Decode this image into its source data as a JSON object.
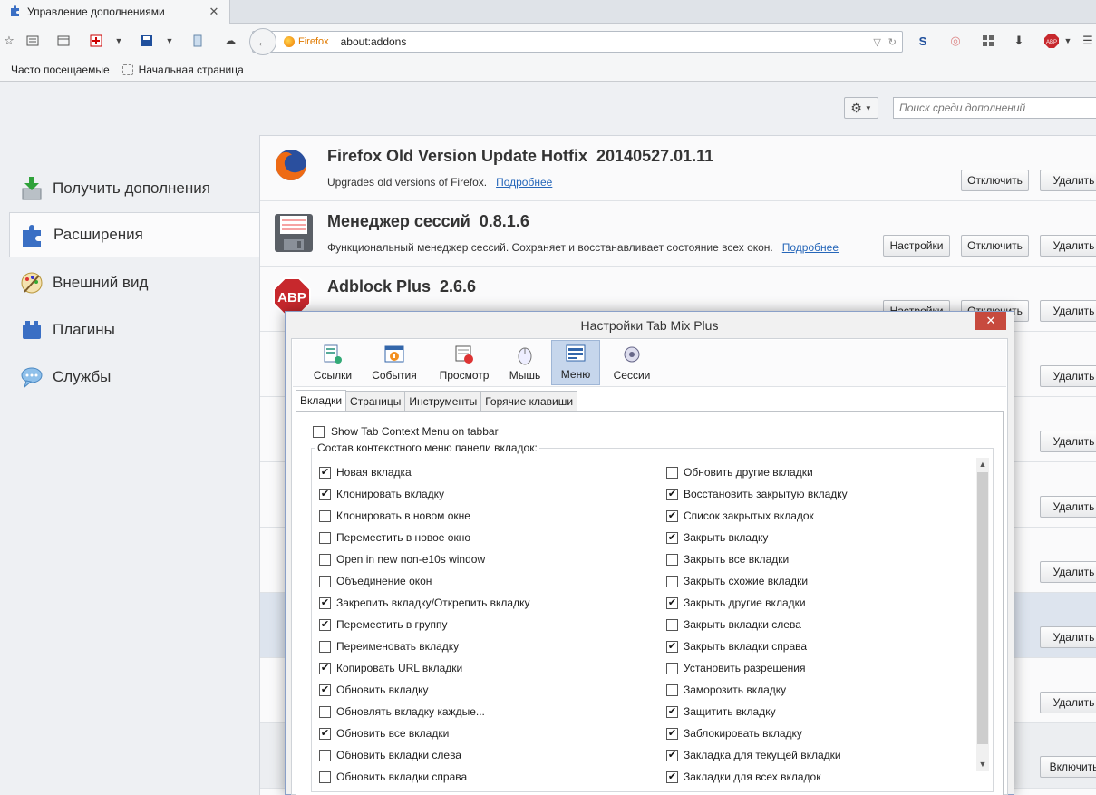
{
  "tab": {
    "title": "Управление дополнениями",
    "close": "✕"
  },
  "nav": {
    "identity_label": "Firefox",
    "url": "about:addons"
  },
  "bookmarks": {
    "items": [
      "Часто посещаемые",
      "Начальная страница"
    ]
  },
  "addons_page": {
    "search_placeholder": "Поиск среди дополнений",
    "categories": [
      {
        "label": "Получить дополнения",
        "icon": "download-icon"
      },
      {
        "label": "Расширения",
        "icon": "puzzle-icon"
      },
      {
        "label": "Внешний вид",
        "icon": "brush-icon"
      },
      {
        "label": "Плагины",
        "icon": "plugin-icon"
      },
      {
        "label": "Службы",
        "icon": "chat-icon"
      }
    ],
    "addons": [
      {
        "name": "Firefox Old Version Update Hotfix",
        "version": "20140527.01.11",
        "description": "Upgrades old versions of Firefox.",
        "more": "Подробнее",
        "buttons": [
          "Отключить",
          "Удалить"
        ]
      },
      {
        "name": "Менеджер сессий",
        "version": "0.8.1.6",
        "description": "Функциональный менеджер сессий. Сохраняет и восстанавливает состояние всех окон.",
        "more": "Подробнее",
        "buttons": [
          "Настройки",
          "Отключить",
          "Удалить"
        ]
      },
      {
        "name": "Adblock Plus",
        "version": "2.6.6",
        "description": "",
        "more": "",
        "buttons": [
          "Настройки",
          "Отключить",
          "Удалить"
        ]
      }
    ],
    "remove_label": "Удалить",
    "enable_label": "Включить"
  },
  "dialog": {
    "title": "Настройки Tab Mix Plus",
    "close": "✕",
    "toolbar": [
      "Ссылки",
      "События",
      "Просмотр",
      "Мышь",
      "Меню",
      "Сессии"
    ],
    "subtabs": [
      "Вкладки",
      "Страницы",
      "Инструменты",
      "Горячие клавиши"
    ],
    "top_check": {
      "label": "Show Tab Context Menu on tabbar",
      "checked": false
    },
    "group_label": "Состав контекстного меню панели вкладок:",
    "left_options": [
      {
        "label": "Новая вкладка",
        "checked": true
      },
      {
        "label": "Клонировать вкладку",
        "checked": true
      },
      {
        "label": "Клонировать в новом окне",
        "checked": false
      },
      {
        "label": "Переместить в новое окно",
        "checked": false
      },
      {
        "label": "Open in new non-e10s window",
        "checked": false
      },
      {
        "label": "Объединение окон",
        "checked": false
      },
      {
        "label": "Закрепить вкладку/Открепить вкладку",
        "checked": true
      },
      {
        "label": "Переместить в группу",
        "checked": true
      },
      {
        "label": "Переименовать вкладку",
        "checked": false
      },
      {
        "label": "Копировать URL вкладки",
        "checked": true
      },
      {
        "label": "Обновить вкладку",
        "checked": true
      },
      {
        "label": "Обновлять вкладку каждые...",
        "checked": false
      },
      {
        "label": "Обновить все вкладки",
        "checked": true
      },
      {
        "label": "Обновить вкладки слева",
        "checked": false
      },
      {
        "label": "Обновить вкладки справа",
        "checked": false
      }
    ],
    "right_options": [
      {
        "label": "Обновить другие вкладки",
        "checked": false
      },
      {
        "label": "Восстановить закрытую вкладку",
        "checked": true
      },
      {
        "label": "Список закрытых вкладок",
        "checked": true
      },
      {
        "label": "Закрыть вкладку",
        "checked": true
      },
      {
        "label": "Закрыть все вкладки",
        "checked": false
      },
      {
        "label": "Закрыть схожие вкладки",
        "checked": false
      },
      {
        "label": "Закрыть другие вкладки",
        "checked": true
      },
      {
        "label": "Закрыть вкладки слева",
        "checked": false
      },
      {
        "label": "Закрыть вкладки справа",
        "checked": true
      },
      {
        "label": "Установить разрешения",
        "checked": false
      },
      {
        "label": "Заморозить вкладку",
        "checked": false
      },
      {
        "label": "Защитить вкладку",
        "checked": true
      },
      {
        "label": "Заблокировать вкладку",
        "checked": true
      },
      {
        "label": "Закладка для текущей вкладки",
        "checked": true
      },
      {
        "label": "Закладки для всех вкладок",
        "checked": true
      }
    ]
  }
}
